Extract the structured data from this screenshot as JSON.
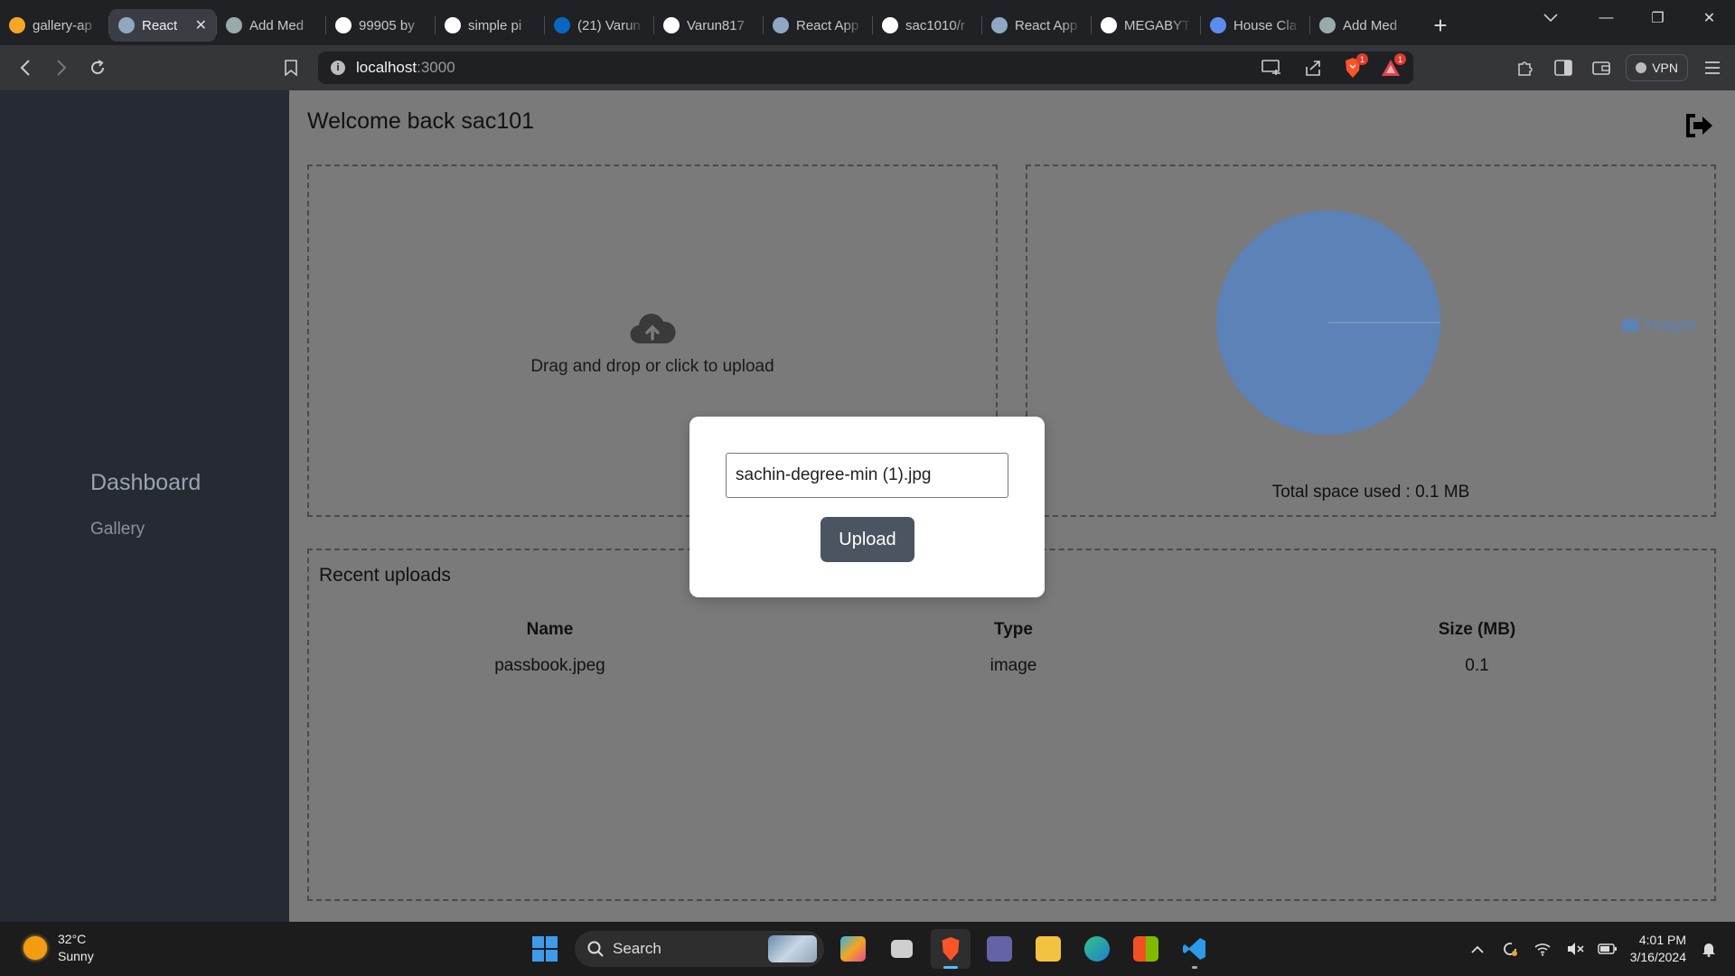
{
  "browser": {
    "tabs": [
      {
        "label": "gallery-ap",
        "icon": "firebase-icon",
        "color": "#f5a623"
      },
      {
        "label": "React",
        "icon": "react-icon",
        "color": "#8fa7c0",
        "active": true
      },
      {
        "label": "Add Med",
        "icon": "openai-icon",
        "color": "#9aa"
      },
      {
        "label": "99905 by",
        "icon": "google-icon",
        "color": "#fff"
      },
      {
        "label": "simple pi",
        "icon": "google-icon",
        "color": "#fff"
      },
      {
        "label": "(21) Varun",
        "icon": "linkedin-icon",
        "color": "#0a66c2"
      },
      {
        "label": "Varun817",
        "icon": "github-icon",
        "color": "#fff"
      },
      {
        "label": "React App",
        "icon": "react-icon",
        "color": "#8fa7c0"
      },
      {
        "label": "sac1010/r",
        "icon": "github-icon",
        "color": "#fff"
      },
      {
        "label": "React App",
        "icon": "react-icon",
        "color": "#8fa7c0"
      },
      {
        "label": "MEGABYT",
        "icon": "google-icon",
        "color": "#fff"
      },
      {
        "label": "House Cla",
        "icon": "flag-icon",
        "color": "#5b8def"
      },
      {
        "label": "Add Med",
        "icon": "openai-icon",
        "color": "#9aa"
      }
    ],
    "url_host": "localhost",
    "url_port": ":3000",
    "shield_count": "1",
    "rewards_count": "1",
    "vpn_label": "VPN"
  },
  "sidebar": {
    "items": [
      {
        "label": "Dashboard"
      },
      {
        "label": "Gallery"
      }
    ]
  },
  "main": {
    "welcome": "Welcome back sac101",
    "upload_prompt": "Drag and drop or click to upload",
    "legend_label": "images",
    "space_used": "Total space used : 0.1 MB",
    "recent": {
      "title": "Recent uploads",
      "columns": [
        "Name",
        "Type",
        "Size (MB)"
      ],
      "rows": [
        [
          "passbook.jpeg",
          "image",
          "0.1"
        ]
      ]
    }
  },
  "chart_data": {
    "type": "pie",
    "categories": [
      "images"
    ],
    "values": [
      0.1
    ],
    "title": "",
    "colors": [
      "#5c82b8"
    ],
    "legend_position": "right"
  },
  "modal": {
    "file_name": "sachin-degree-min (1).jpg",
    "upload_label": "Upload"
  },
  "taskbar": {
    "temperature": "32°C",
    "condition": "Sunny",
    "search_label": "Search",
    "time": "4:01 PM",
    "date": "3/16/2024"
  }
}
